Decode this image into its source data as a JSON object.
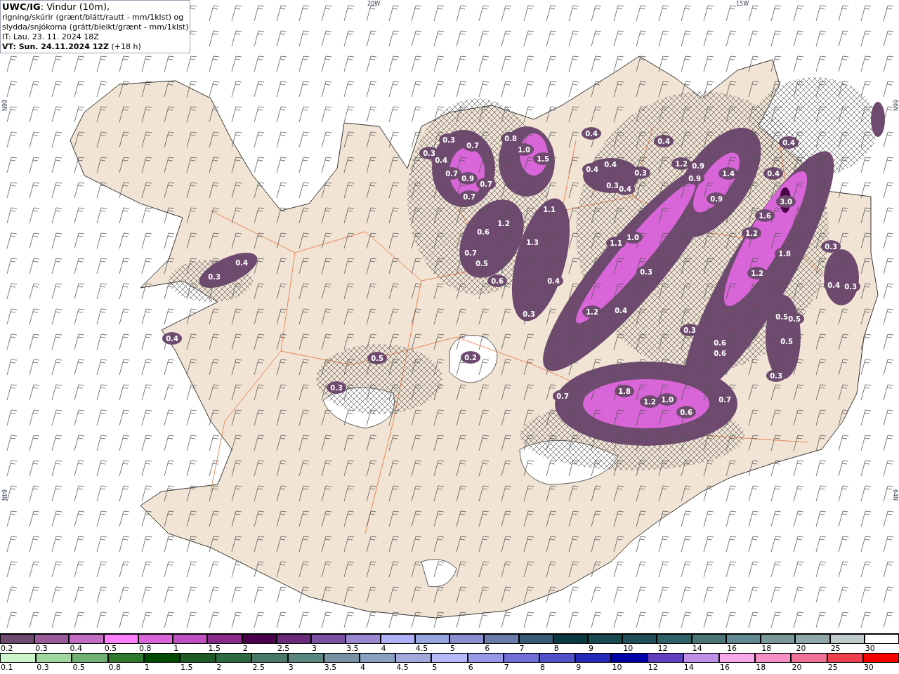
{
  "header": {
    "lines": [
      "**UWC/IG**: Vindur (10m),",
      "rigning/skúrir (grænt/blátt/rautt - mm/1klst) og",
      "slydda/snjókoma (grátt/bleikt/grænt - mm/1klst)",
      "IT: Lau. 23. 11. 2024 18Z",
      "**VT: Sun. 24.11.2024 12Z** (+18 h)"
    ]
  },
  "map": {
    "axis_labels": [
      "20W",
      "15W",
      "66N",
      "66N",
      "64N",
      "64N"
    ],
    "precip_values": [
      "0.3",
      "0.7",
      "0.3",
      "0.4",
      "0.7",
      "0.9",
      "0.7",
      "0.7",
      "0.8",
      "1.0",
      "1.5",
      "1.1",
      "1.2",
      "0.6",
      "1.3",
      "0.7",
      "0.5",
      "0.6",
      "0.4",
      "0.4",
      "0.4",
      "0.4",
      "0.3",
      "0.4",
      "0.3",
      "1.1",
      "1.0",
      "0.3",
      "0.4",
      "1.2",
      "0.9",
      "0.9",
      "1.4",
      "0.9",
      "0.4",
      "0.4",
      "3.0",
      "1.6",
      "1.2",
      "1.8",
      "1.2",
      "0.3",
      "0.4",
      "0.3",
      "0.5",
      "0.5",
      "0.5",
      "0.3",
      "0.6",
      "0.6",
      "0.3",
      "0.4",
      "0.3",
      "0.4",
      "0.5",
      "0.3",
      "0.2",
      "1.2",
      "0.4",
      "0.3",
      "0.7",
      "1.8",
      "1.2",
      "1.0",
      "0.6",
      "0.7"
    ]
  },
  "legend": {
    "top": [
      {
        "label": "0.2",
        "color": "#6e4a6e"
      },
      {
        "label": "0.3",
        "color": "#9a5a9a"
      },
      {
        "label": "0.4",
        "color": "#c36cc3"
      },
      {
        "label": "0.5",
        "color": "#ff80ff"
      },
      {
        "label": "0.8",
        "color": "#d966d9"
      },
      {
        "label": "1",
        "color": "#c050c0"
      },
      {
        "label": "1.5",
        "color": "#8a2a8a"
      },
      {
        "label": "2",
        "color": "#4a004a"
      },
      {
        "label": "2.5",
        "color": "#6a2a7a"
      },
      {
        "label": "3",
        "color": "#7a50a0"
      },
      {
        "label": "3.5",
        "color": "#9a88d0"
      },
      {
        "label": "4",
        "color": "#b0b0f8"
      },
      {
        "label": "4.5",
        "color": "#98a4e0"
      },
      {
        "label": "5",
        "color": "#8890d0"
      },
      {
        "label": "6",
        "color": "#6a7aaa"
      },
      {
        "label": "7",
        "color": "#3a5a78"
      },
      {
        "label": "8",
        "color": "#0a3a40"
      },
      {
        "label": "9",
        "color": "#1a4a50"
      },
      {
        "label": "10",
        "color": "#225058"
      },
      {
        "label": "12",
        "color": "#306068"
      },
      {
        "label": "14",
        "color": "#4a7478"
      },
      {
        "label": "16",
        "color": "#608a90"
      },
      {
        "label": "18",
        "color": "#7a9898"
      },
      {
        "label": "20",
        "color": "#90a8a8"
      },
      {
        "label": "25",
        "color": "#c0cccc"
      },
      {
        "label": "30",
        "color": "#ffffff"
      }
    ],
    "bottom": [
      {
        "label": "0.1",
        "color": "#ccf5cc"
      },
      {
        "label": "0.3",
        "color": "#a0d8a0"
      },
      {
        "label": "0.5",
        "color": "#70b070"
      },
      {
        "label": "0.8",
        "color": "#307a30"
      },
      {
        "label": "1",
        "color": "#004a00"
      },
      {
        "label": "1.5",
        "color": "#1e5a28"
      },
      {
        "label": "2",
        "color": "#2e6a40"
      },
      {
        "label": "2.5",
        "color": "#4a7868"
      },
      {
        "label": "3",
        "color": "#5a8880"
      },
      {
        "label": "3.5",
        "color": "#7890a0"
      },
      {
        "label": "4",
        "color": "#8aa0c0"
      },
      {
        "label": "4.5",
        "color": "#a0a8dc"
      },
      {
        "label": "5",
        "color": "#b8b8f8"
      },
      {
        "label": "6",
        "color": "#9898e8"
      },
      {
        "label": "7",
        "color": "#7070d8"
      },
      {
        "label": "8",
        "color": "#5050c8"
      },
      {
        "label": "9",
        "color": "#2828b8"
      },
      {
        "label": "10",
        "color": "#0000a8"
      },
      {
        "label": "12",
        "color": "#6040c0"
      },
      {
        "label": "14",
        "color": "#c090e8"
      },
      {
        "label": "16",
        "color": "#f8a8e8"
      },
      {
        "label": "18",
        "color": "#f890c8"
      },
      {
        "label": "20",
        "color": "#f07098"
      },
      {
        "label": "25",
        "color": "#f04050"
      },
      {
        "label": "30",
        "color": "#f80000"
      }
    ]
  }
}
